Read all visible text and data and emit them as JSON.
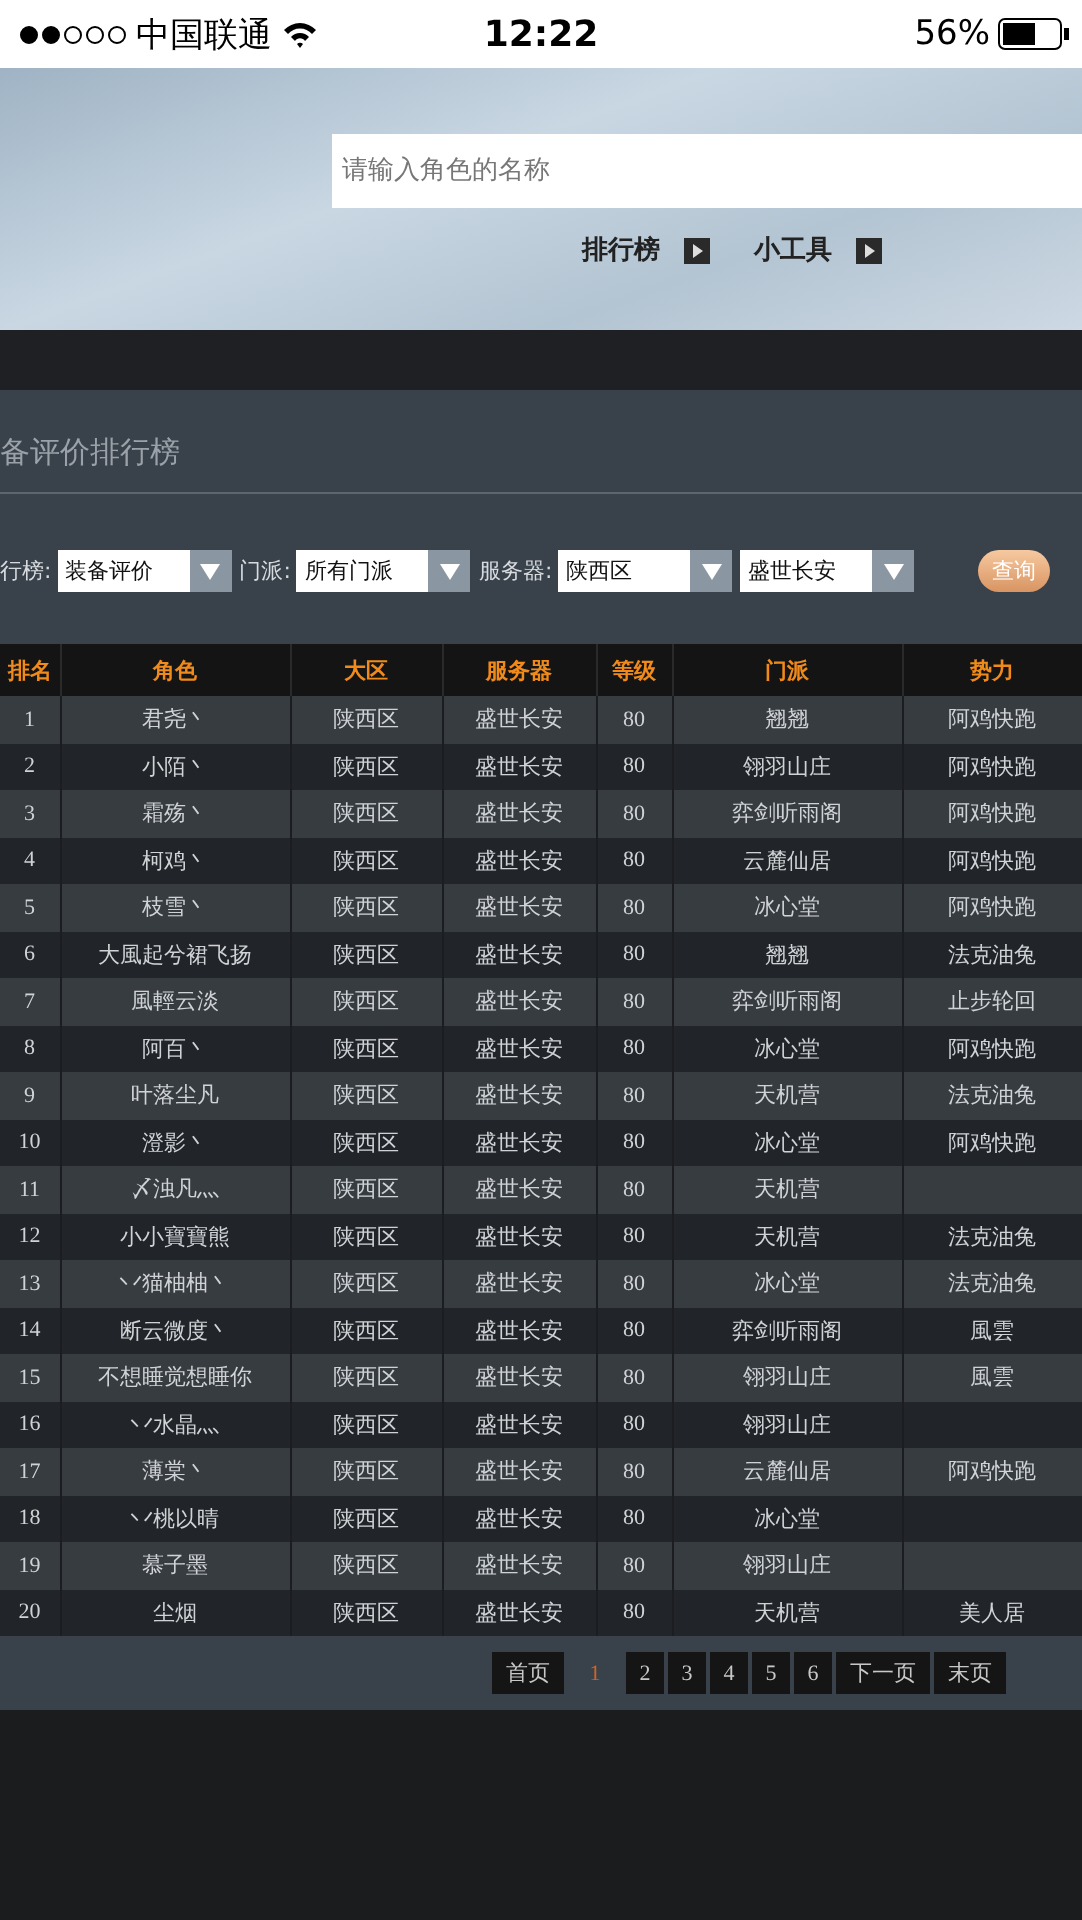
{
  "status_bar": {
    "carrier": "中国联通",
    "time": "12:22",
    "battery": "56%"
  },
  "header": {
    "search": {
      "placeholder": "请输入角色的名称"
    },
    "links": [
      "排行榜",
      "小工具"
    ]
  },
  "panel": {
    "title": "备评价排行榜",
    "filters": [
      {
        "label": "行榜:",
        "value": "装备评价"
      },
      {
        "label": "门派:",
        "value": "所有门派"
      },
      {
        "label": "服务器:",
        "value": "陕西区"
      },
      {
        "value": "盛世长安"
      }
    ],
    "query_button": "查询"
  },
  "table": {
    "columns": [
      "排名",
      "角色",
      "大区",
      "服务器",
      "等级",
      "门派",
      "势力"
    ],
    "rows": [
      {
        "rank": "1",
        "character": "君尧丶",
        "region": "陕西区",
        "server": "盛世长安",
        "level": "80",
        "sect": "翘翘",
        "faction": "阿鸡快跑"
      },
      {
        "rank": "2",
        "character": "小陌丶",
        "region": "陕西区",
        "server": "盛世长安",
        "level": "80",
        "sect": "翎羽山庄",
        "faction": "阿鸡快跑"
      },
      {
        "rank": "3",
        "character": "霜殇丶",
        "region": "陕西区",
        "server": "盛世长安",
        "level": "80",
        "sect": "弈剑听雨阁",
        "faction": "阿鸡快跑"
      },
      {
        "rank": "4",
        "character": "柯鸡丶",
        "region": "陕西区",
        "server": "盛世长安",
        "level": "80",
        "sect": "云麓仙居",
        "faction": "阿鸡快跑"
      },
      {
        "rank": "5",
        "character": "枝雪丶",
        "region": "陕西区",
        "server": "盛世长安",
        "level": "80",
        "sect": "冰心堂",
        "faction": "阿鸡快跑"
      },
      {
        "rank": "6",
        "character": "大風起兮裙飞扬",
        "region": "陕西区",
        "server": "盛世长安",
        "level": "80",
        "sect": "翘翘",
        "faction": "法克油兔"
      },
      {
        "rank": "7",
        "character": "風輕云淡",
        "region": "陕西区",
        "server": "盛世长安",
        "level": "80",
        "sect": "弈剑听雨阁",
        "faction": "止步轮回"
      },
      {
        "rank": "8",
        "character": "阿百丶",
        "region": "陕西区",
        "server": "盛世长安",
        "level": "80",
        "sect": "冰心堂",
        "faction": "阿鸡快跑"
      },
      {
        "rank": "9",
        "character": "叶落尘凡",
        "region": "陕西区",
        "server": "盛世长安",
        "level": "80",
        "sect": "天机营",
        "faction": "法克油兔"
      },
      {
        "rank": "10",
        "character": "澄影丶",
        "region": "陕西区",
        "server": "盛世长安",
        "level": "80",
        "sect": "冰心堂",
        "faction": "阿鸡快跑"
      },
      {
        "rank": "11",
        "character": "〆浊凡灬",
        "region": "陕西区",
        "server": "盛世长安",
        "level": "80",
        "sect": "天机营"
      },
      {
        "rank": "12",
        "character": "小小寶寶熊",
        "region": "陕西区",
        "server": "盛世长安",
        "level": "80",
        "sect": "天机营",
        "faction": "法克油兔"
      },
      {
        "rank": "13",
        "character": "丷猫柚柚丶",
        "region": "陕西区",
        "server": "盛世长安",
        "level": "80",
        "sect": "冰心堂",
        "faction": "法克油兔"
      },
      {
        "rank": "14",
        "character": "断云微度丶",
        "region": "陕西区",
        "server": "盛世长安",
        "level": "80",
        "sect": "弈剑听雨阁",
        "faction": "風雲"
      },
      {
        "rank": "15",
        "character": "不想睡觉想睡你",
        "region": "陕西区",
        "server": "盛世长安",
        "level": "80",
        "sect": "翎羽山庄",
        "faction": "風雲"
      },
      {
        "rank": "16",
        "character": "丷水晶灬",
        "region": "陕西区",
        "server": "盛世长安",
        "level": "80",
        "sect": "翎羽山庄"
      },
      {
        "rank": "17",
        "character": "薄棠丶",
        "region": "陕西区",
        "server": "盛世长安",
        "level": "80",
        "sect": "云麓仙居",
        "faction": "阿鸡快跑"
      },
      {
        "rank": "18",
        "character": "丷桃以晴",
        "region": "陕西区",
        "server": "盛世长安",
        "level": "80",
        "sect": "冰心堂"
      },
      {
        "rank": "19",
        "character": "慕子墨",
        "region": "陕西区",
        "server": "盛世长安",
        "level": "80",
        "sect": "翎羽山庄"
      },
      {
        "rank": "20",
        "character": "尘烟",
        "region": "陕西区",
        "server": "盛世长安",
        "level": "80",
        "sect": "天机营",
        "faction": "美人居"
      }
    ]
  },
  "pagination": {
    "first": "首页",
    "pages": [
      {
        "label": "1",
        "selected": true
      },
      {
        "label": "2",
        "selected": false
      },
      {
        "label": "3",
        "selected": false
      },
      {
        "label": "4",
        "selected": false
      },
      {
        "label": "5",
        "selected": false
      },
      {
        "label": "6",
        "selected": false
      }
    ],
    "next": "下一页",
    "last": "末页"
  }
}
